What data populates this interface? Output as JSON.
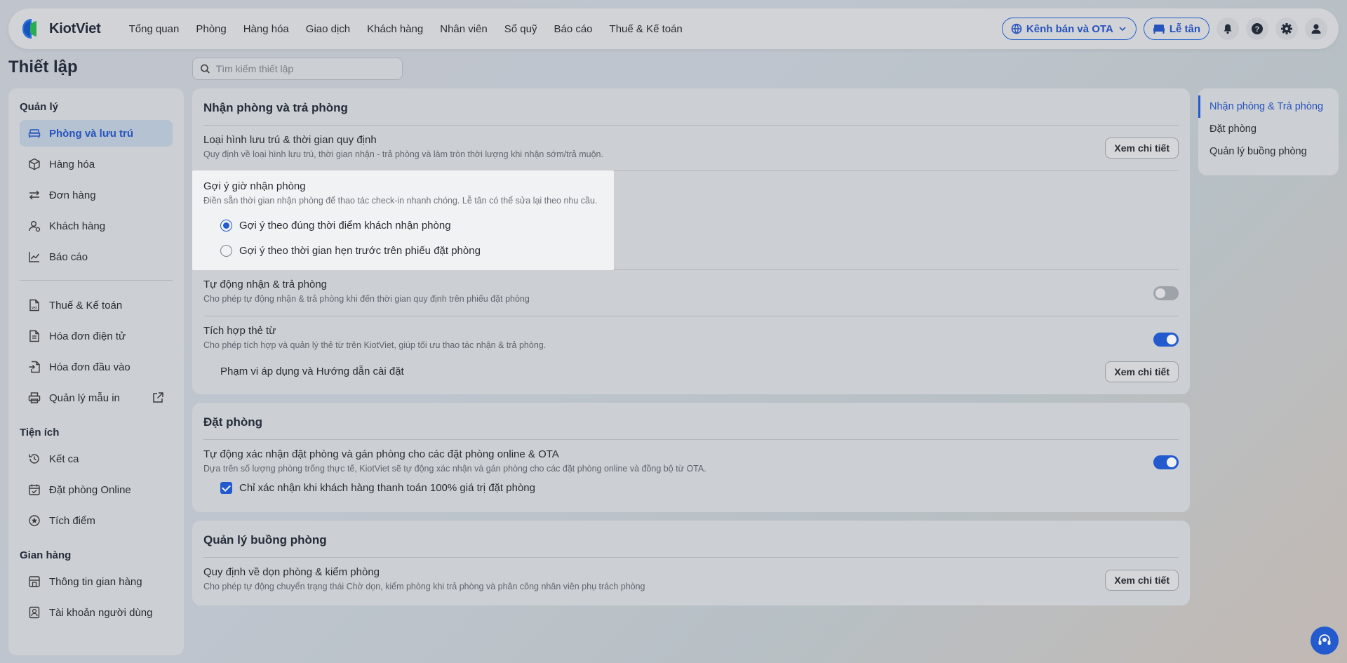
{
  "brand": {
    "name": "KiotViet"
  },
  "nav": [
    "Tổng quan",
    "Phòng",
    "Hàng hóa",
    "Giao dịch",
    "Khách hàng",
    "Nhân viên",
    "Sổ quỹ",
    "Báo cáo",
    "Thuế & Kế toán"
  ],
  "topbar": {
    "channel_button": "Kênh bán và OTA",
    "reception_button": "Lễ tân",
    "icons": [
      "bell-icon",
      "help-icon",
      "gear-icon",
      "user-icon"
    ]
  },
  "page": {
    "title": "Thiết lập",
    "search_placeholder": "Tìm kiếm thiết lập"
  },
  "sidebar": {
    "sections": [
      {
        "title": "Quản lý",
        "items": [
          {
            "label": "Phòng và lưu trú",
            "icon": "bed-icon",
            "active": true
          },
          {
            "label": "Hàng hóa",
            "icon": "box-icon"
          },
          {
            "label": "Đơn hàng",
            "icon": "swap-icon"
          },
          {
            "label": "Khách hàng",
            "icon": "customer-icon"
          },
          {
            "label": "Báo cáo",
            "icon": "chart-icon"
          }
        ]
      },
      {
        "title": "",
        "items": [
          {
            "label": "Thuế & Kế toán",
            "icon": "vat-doc-icon"
          },
          {
            "label": "Hóa đơn điện tử",
            "icon": "invoice-icon"
          },
          {
            "label": "Hóa đơn đầu vào",
            "icon": "invoice-in-icon"
          },
          {
            "label": "Quản lý mẫu in",
            "icon": "printer-icon"
          }
        ]
      },
      {
        "title": "Tiện ích",
        "items": [
          {
            "label": "Kết ca",
            "icon": "history-icon"
          },
          {
            "label": "Đặt phòng Online",
            "icon": "calendar-check-icon"
          },
          {
            "label": "Tích điểm",
            "icon": "star-circle-icon"
          }
        ]
      },
      {
        "title": "Gian hàng",
        "items": [
          {
            "label": "Thông tin gian hàng",
            "icon": "store-icon"
          },
          {
            "label": "Tài khoản người dùng",
            "icon": "user-badge-icon"
          }
        ]
      }
    ]
  },
  "cards": {
    "checkin": {
      "title": "Nhận phòng và trả phòng",
      "row1": {
        "title": "Loại hình lưu trú & thời gian quy định",
        "desc": "Quy định về loại hình lưu trú, thời gian nhận - trả phòng và làm tròn thời lượng khi nhận sớm/trả muộn.",
        "button": "Xem chi tiết"
      },
      "suggest": {
        "title": "Gợi ý giờ nhận phòng",
        "desc": "Điền sẵn thời gian nhận phòng để thao tác check-in nhanh chóng. Lễ tân có thể sửa lại theo nhu cầu.",
        "options": [
          "Gợi ý theo đúng thời điểm khách nhận phòng",
          "Gợi ý theo thời gian hẹn trước trên phiếu đặt phòng"
        ],
        "selected": 0
      },
      "auto": {
        "title": "Tự động nhận & trả phòng",
        "desc": "Cho phép tự động nhận & trả phòng khi đến thời gian quy định trên phiếu đặt phòng",
        "enabled": false
      },
      "card_key": {
        "title": "Tích hợp thẻ từ",
        "desc": "Cho phép tích hợp và quản lý thẻ từ trên KiotViet, giúp tối ưu thao tác nhận & trả phòng.",
        "enabled": true,
        "sub_label": "Phạm vi áp dụng và Hướng dẫn cài đặt",
        "button": "Xem chi tiết"
      }
    },
    "booking": {
      "title": "Đặt phòng",
      "row": {
        "title": "Tự động xác nhận đặt phòng và gán phòng cho các đặt phòng online & OTA",
        "desc": "Dựa trên số lượng phòng trống thực tế, KiotViet sẽ tự động xác nhận và gán phòng cho các đặt phòng online và đồng bộ từ OTA.",
        "enabled": true,
        "checkbox_label": "Chỉ xác nhận khi khách hàng thanh toán 100% giá trị đặt phòng",
        "checked": true
      }
    },
    "housekeeping": {
      "title": "Quản lý buồng phòng",
      "row": {
        "title": "Quy định về dọn phòng & kiểm phòng",
        "desc": "Cho phép tự động chuyển trạng thái Chờ dọn, kiểm phòng khi trả phòng và phân công nhân viên phụ trách phòng",
        "button": "Xem chi tiết"
      }
    }
  },
  "toc": [
    "Nhận phòng & Trả phòng",
    "Đặt phòng",
    "Quản lý buồng phòng"
  ],
  "colors": {
    "accent": "#1a57d6",
    "active_bg": "#bccadb"
  }
}
